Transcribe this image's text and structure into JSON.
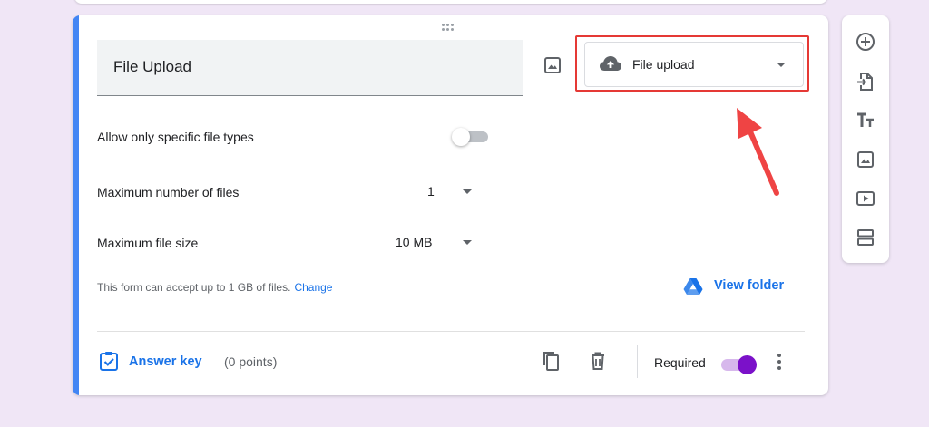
{
  "question": {
    "title": "File Upload",
    "type_label": "File upload"
  },
  "settings": {
    "specific_types_label": "Allow only specific file types",
    "specific_types_enabled": false,
    "max_files_label": "Maximum number of files",
    "max_files_value": "1",
    "max_size_label": "Maximum file size",
    "max_size_value": "10 MB"
  },
  "notice": {
    "text": "This form can accept up to 1 GB of files.",
    "change_label": "Change",
    "view_folder_label": "View folder"
  },
  "footer": {
    "answer_key_label": "Answer key",
    "points_label": "(0 points)",
    "required_label": "Required",
    "required_enabled": true
  },
  "toolbar": {
    "items": [
      "add-question-icon",
      "import-questions-icon",
      "add-title-icon",
      "add-image-icon",
      "add-video-icon",
      "add-section-icon"
    ]
  },
  "colors": {
    "background": "#f0e6f6",
    "accent_blue": "#4285f4",
    "link_blue": "#1a73e8",
    "highlight_red": "#e53935",
    "toggle_purple": "#7b11c9"
  }
}
